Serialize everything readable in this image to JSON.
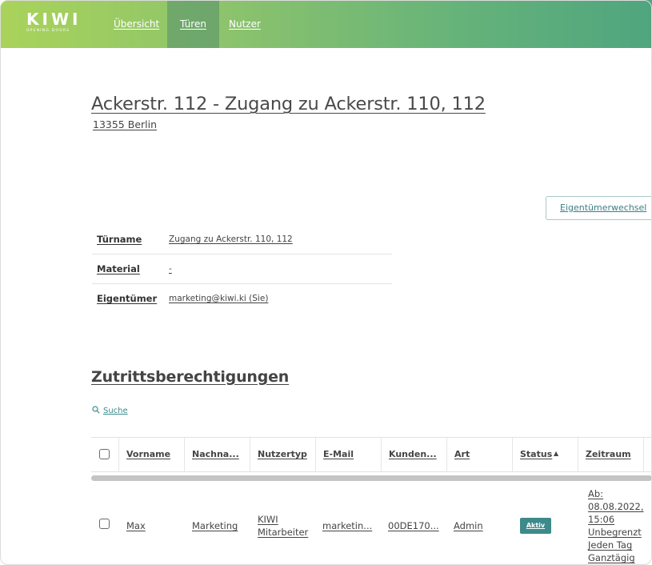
{
  "navbar": {
    "logo_text": "KIWI",
    "logo_subtitle": "OPENING DOORS",
    "links": [
      "Übersicht",
      "Türen",
      "Nutzer"
    ],
    "active_link": "Türen"
  },
  "door": {
    "title": "Ackerstr. 112 - Zugang zu Ackerstr. 110, 112",
    "subtitle": "13355 Berlin",
    "owner_change_button": "Eigentümerwechsel",
    "details": [
      {
        "label": "Türname",
        "value": "Zugang zu Ackerstr. 110, 112"
      },
      {
        "label": "Material",
        "value": "-"
      },
      {
        "label": "Eigentümer",
        "value": "marketing@kiwi.ki (Sie)"
      }
    ]
  },
  "permissions": {
    "title": "Zutrittsberechtigungen",
    "search_label": "Suche",
    "search_icon": "search-icon",
    "columns": [
      "Vorname",
      "Nachna...",
      "Nutzertyp",
      "E-Mail",
      "Kunden...",
      "Art",
      "Status",
      "Zeitraum"
    ],
    "sorted_column": "Status",
    "sort_indicator": "▲",
    "rows": [
      {
        "vorname": "Max",
        "nachname": "Marketing",
        "nutzertyp_line1": "KIWI",
        "nutzertyp_line2": "Mitarbeiter",
        "email": "marketin...",
        "kunden": "00DE170...",
        "art": "Admin",
        "status": "Aktiv",
        "zeitraum": [
          "Ab:",
          "08.08.2022,",
          "15:06",
          "Unbegrenzt",
          "Jeden Tag",
          "Ganztägig"
        ]
      }
    ]
  },
  "colors": {
    "nav_gradient_start": "#a9d35a",
    "nav_gradient_end": "#4fa57e",
    "accent": "#3c8b8a"
  }
}
